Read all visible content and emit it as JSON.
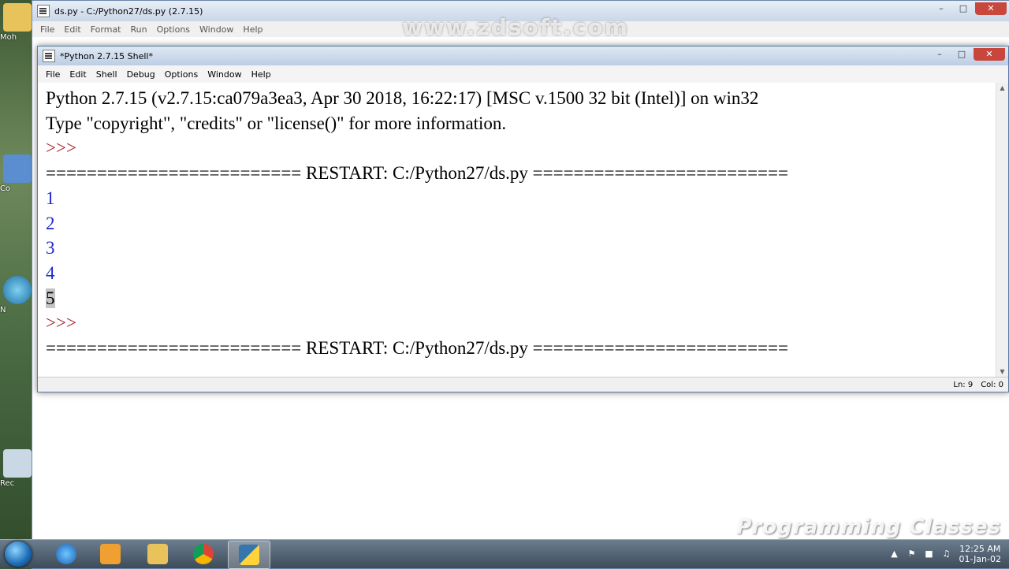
{
  "desktop": {
    "icons": [
      "Moh",
      "Co",
      "N",
      "Rec"
    ]
  },
  "editor_window": {
    "title": "ds.py - C:/Python27/ds.py (2.7.15)",
    "menu": [
      "File",
      "Edit",
      "Format",
      "Run",
      "Options",
      "Window",
      "Help"
    ]
  },
  "watermark_top": "www.zdsoft.com",
  "shell_window": {
    "title": "*Python 2.7.15 Shell*",
    "menu": [
      "File",
      "Edit",
      "Shell",
      "Debug",
      "Options",
      "Window",
      "Help"
    ],
    "lines": {
      "banner": "Python 2.7.15 (v2.7.15:ca079a3ea3, Apr 30 2018, 16:22:17) [MSC v.1500 32 bit (Intel)] on win32",
      "info": "Type \"copyright\", \"credits\" or \"license()\" for more information.",
      "prompt1": ">>> ",
      "restart1": "========================= RESTART: C:/Python27/ds.py =========================",
      "out1": "1",
      "out2": "2",
      "out3": "3",
      "out4": "4",
      "out5": "5",
      "prompt2": ">>> ",
      "restart2": "========================= RESTART: C:/Python27/ds.py ========================="
    },
    "status": {
      "line": "Ln: 9",
      "col": "Col: 0"
    }
  },
  "watermark_bottom": "Programming Classes",
  "taskbar": {
    "clock_time": "12:25 AM",
    "clock_date": "01-Jan-02"
  },
  "colors": {
    "prompt": "#a0181c",
    "output": "#1c2ac8"
  }
}
